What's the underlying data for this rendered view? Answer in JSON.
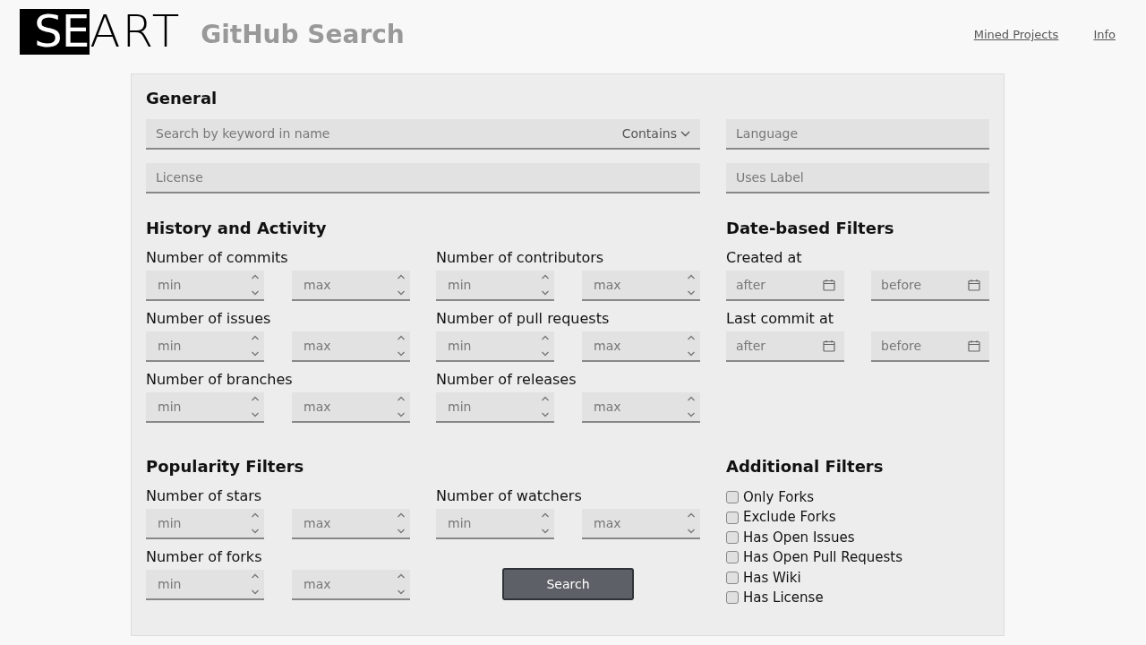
{
  "header": {
    "logo_highlighted": "SE",
    "logo_rest": "ART",
    "title": "GitHub Search",
    "nav_links": [
      "Mined Projects",
      "Info"
    ]
  },
  "general": {
    "heading": "General",
    "keyword_field": {
      "placeholder": "Search by keyword in name",
      "match_mode": "Contains"
    },
    "license_field": {
      "placeholder": "License"
    },
    "language_field": {
      "placeholder": "Language"
    },
    "label_field": {
      "placeholder": "Uses Label"
    }
  },
  "history": {
    "heading": "History and Activity",
    "filters": [
      {
        "label": "Number of commits",
        "min_placeholder": "min",
        "max_placeholder": "max"
      },
      {
        "label": "Number of contributors",
        "min_placeholder": "min",
        "max_placeholder": "max"
      },
      {
        "label": "Number of issues",
        "min_placeholder": "min",
        "max_placeholder": "max"
      },
      {
        "label": "Number of pull requests",
        "min_placeholder": "min",
        "max_placeholder": "max"
      },
      {
        "label": "Number of branches",
        "min_placeholder": "min",
        "max_placeholder": "max"
      },
      {
        "label": "Number of releases",
        "min_placeholder": "min",
        "max_placeholder": "max"
      }
    ]
  },
  "dates": {
    "heading": "Date-based Filters",
    "filters": [
      {
        "label": "Created at",
        "after_placeholder": "after",
        "before_placeholder": "before"
      },
      {
        "label": "Last commit at",
        "after_placeholder": "after",
        "before_placeholder": "before"
      }
    ]
  },
  "popularity": {
    "heading": "Popularity Filters",
    "filters": [
      {
        "label": "Number of stars",
        "min_placeholder": "min",
        "max_placeholder": "max"
      },
      {
        "label": "Number of watchers",
        "min_placeholder": "min",
        "max_placeholder": "max"
      },
      {
        "label": "Number of forks",
        "min_placeholder": "min",
        "max_placeholder": "max"
      }
    ]
  },
  "additional": {
    "heading": "Additional Filters",
    "options": [
      {
        "label": "Only Forks",
        "checked": false
      },
      {
        "label": "Exclude Forks",
        "checked": false
      },
      {
        "label": "Has Open Issues",
        "checked": false
      },
      {
        "label": "Has Open Pull Requests",
        "checked": false
      },
      {
        "label": "Has Wiki",
        "checked": false
      },
      {
        "label": "Has License",
        "checked": false
      }
    ]
  },
  "search_button": "Search"
}
